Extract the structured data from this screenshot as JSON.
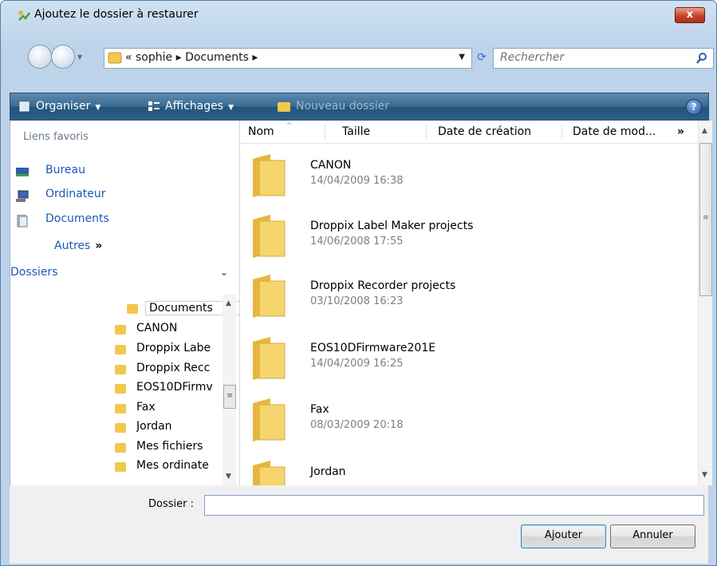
{
  "window": {
    "title": "Ajoutez le dossier à restaurer",
    "close_label": "x"
  },
  "nav": {
    "address_text": "« sophie ▸ Documents ▸",
    "search_placeholder": "Rechercher"
  },
  "toolbar": {
    "organize": "Organiser",
    "views": "Affichages",
    "new_folder": "Nouveau dossier",
    "help": "?"
  },
  "favorites": {
    "title": "Liens favoris",
    "items": [
      {
        "label": "Bureau",
        "icon": "desktop-icon"
      },
      {
        "label": "Ordinateur",
        "icon": "computer-icon"
      },
      {
        "label": "Documents",
        "icon": "documents-icon"
      }
    ],
    "more": "Autres"
  },
  "folders_pane": {
    "title": "Dossiers",
    "root": "Documents",
    "items": [
      "CANON",
      "Droppix Labe",
      "Droppix Recc",
      "EOS10DFirmv",
      "Fax",
      "Jordan",
      "Mes fichiers",
      "Mes ordinate"
    ]
  },
  "columns": [
    "Nom",
    "Taille",
    "Date de création",
    "Date de mod...",
    "»"
  ],
  "files": [
    {
      "name": "CANON",
      "date": "14/04/2009 16:38"
    },
    {
      "name": "Droppix Label Maker projects",
      "date": "14/06/2008 17:55"
    },
    {
      "name": "Droppix Recorder projects",
      "date": "03/10/2008 16:23"
    },
    {
      "name": "EOS10DFirmware201E",
      "date": "14/04/2009 16:25"
    },
    {
      "name": "Fax",
      "date": "08/03/2009 20:18"
    },
    {
      "name": "Jordan",
      "date": ""
    }
  ],
  "footer": {
    "folder_label": "Dossier :",
    "folder_value": "",
    "add_button": "Ajouter",
    "cancel_button": "Annuler"
  }
}
